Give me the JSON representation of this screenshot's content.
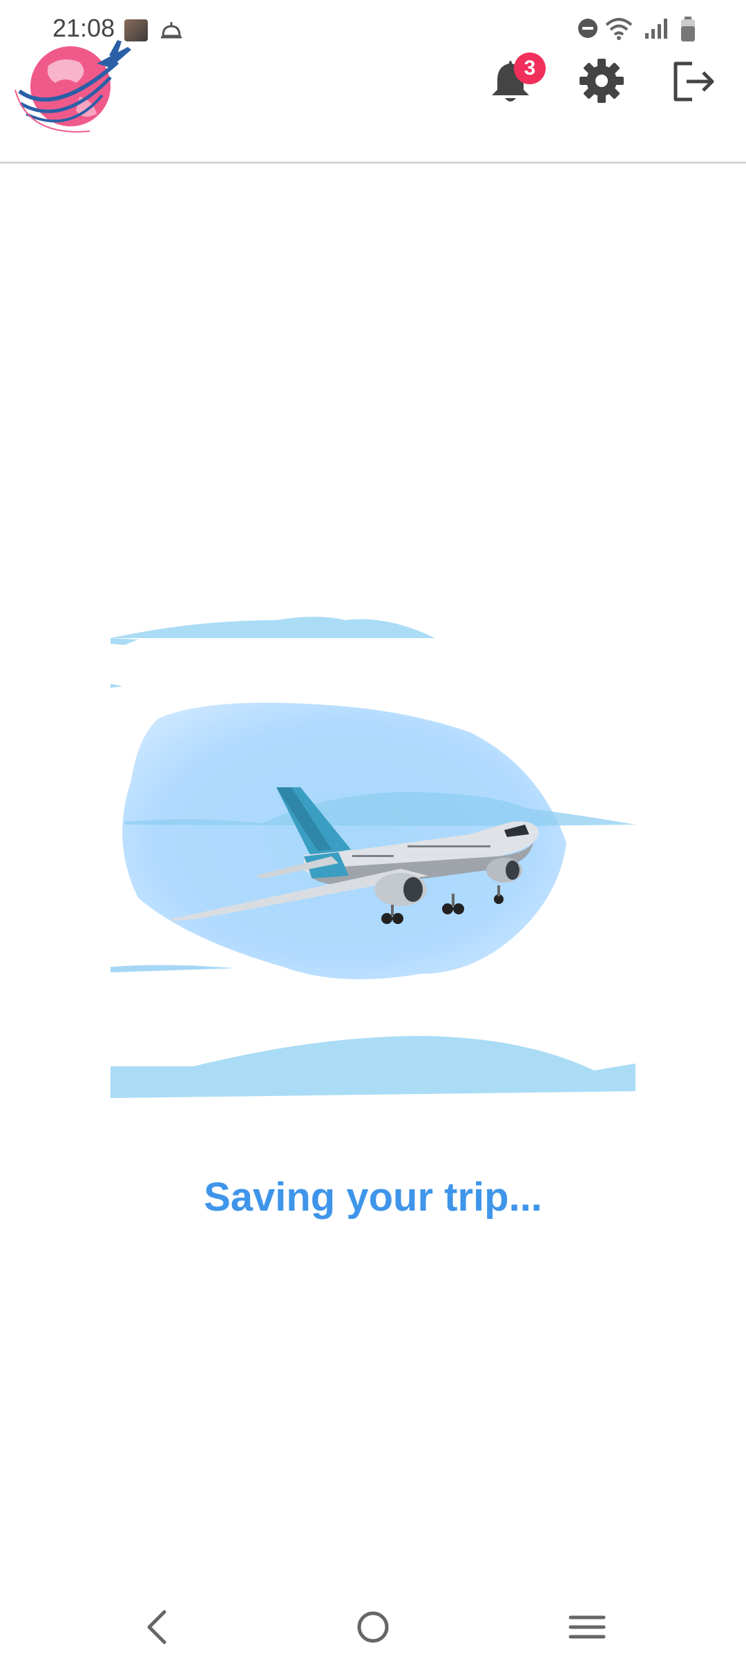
{
  "status_bar": {
    "time": "21:08"
  },
  "header": {
    "notification_count": "3"
  },
  "main": {
    "loading_text": "Saving your trip..."
  },
  "icons": {
    "logo": "globe-airplane-logo",
    "notifications": "bell-icon",
    "settings": "gear-icon",
    "logout": "logout-icon",
    "nav_back": "back-chevron-icon",
    "nav_home": "home-circle-icon",
    "nav_menu": "menu-lines-icon"
  },
  "colors": {
    "accent": "#3f95ea",
    "badge": "#f0305a",
    "logo_pink": "#f05a8a",
    "logo_blue": "#2b5fa6"
  }
}
